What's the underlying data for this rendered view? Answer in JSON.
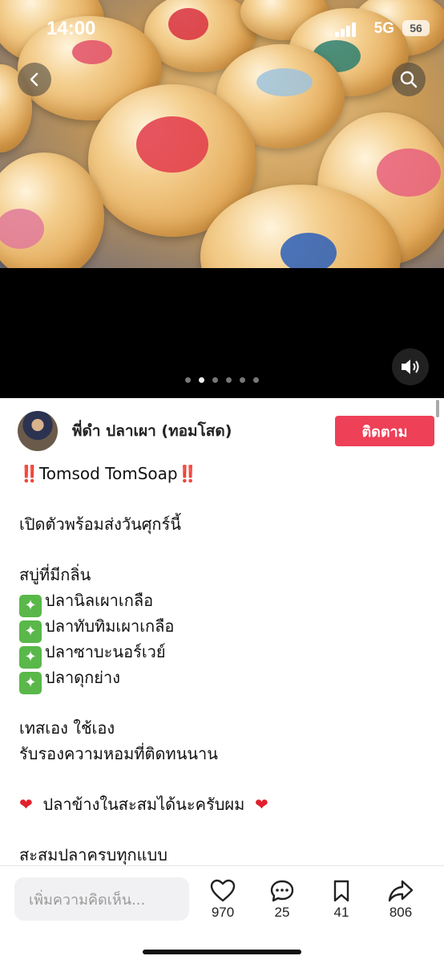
{
  "status_bar": {
    "time": "14:00",
    "network": "5G",
    "battery": "56"
  },
  "media": {
    "slide_count": 6,
    "active_index": 1
  },
  "author": {
    "name": "พี่ดำ ปลาเผา (ทอมโสด)",
    "follow_label": "ติดตาม"
  },
  "post": {
    "title_prefix": "‼️",
    "title_text": "Tomsod TomSoap",
    "title_suffix": "‼️",
    "line_open": "เปิดตัวพร้อมส่งวันศุกร์นี้",
    "scent_heading": "สบู่ที่มีกลิ่น",
    "scents": [
      "ปลานิลเผาเกลือ",
      "ปลาทับทิมเผาเกลือ",
      "ปลาซาบะนอร์เวย์",
      "ปลาดุกย่าง"
    ],
    "line_test": "เทสเอง ใช้เอง",
    "line_guarantee": "รับรองความหอมที่ติดทนนาน",
    "line_collect": "ปลาข้างในสะสมได้นะครับผม",
    "line_partial": "สะสมปลาครบทุกแบบ"
  },
  "bottom_bar": {
    "comment_placeholder": "เพิ่มความคิดเห็น...",
    "likes": "970",
    "comments": "25",
    "saves": "41",
    "shares": "806"
  },
  "colors": {
    "follow_bg": "#ee4057",
    "sparkle_bg": "#59b849",
    "heart": "#e0202c"
  }
}
